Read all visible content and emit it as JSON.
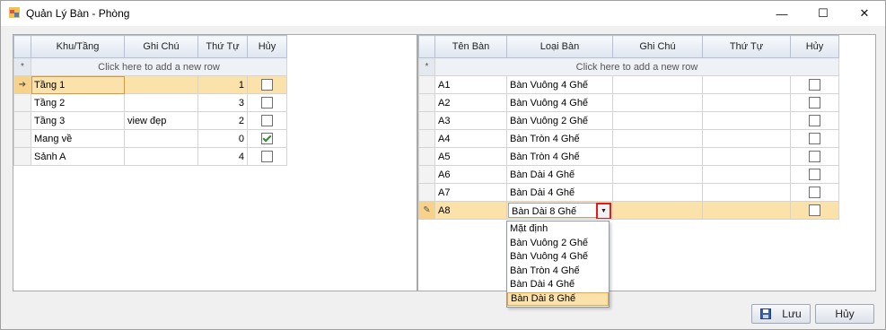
{
  "window": {
    "title": "Quản Lý Bàn - Phòng",
    "minimize_glyph": "—",
    "maximize_glyph": "☐",
    "close_glyph": "✕"
  },
  "left_grid": {
    "columns": [
      "Khu/Tầng",
      "Ghi Chú",
      "Thứ Tự",
      "Hủy"
    ],
    "new_row_text": "Click here to add a new row",
    "new_row_indicator": "*",
    "current_row_indicator": "➔",
    "rows": [
      {
        "area": "Tầng 1",
        "note": "",
        "order": "1",
        "cancel": false
      },
      {
        "area": "Tầng 2",
        "note": "",
        "order": "3",
        "cancel": false
      },
      {
        "area": "Tầng 3",
        "note": "view đẹp",
        "order": "2",
        "cancel": false
      },
      {
        "area": "Mang về",
        "note": "",
        "order": "0",
        "cancel": true
      },
      {
        "area": "Sảnh A",
        "note": "",
        "order": "4",
        "cancel": false
      }
    ]
  },
  "right_grid": {
    "columns": [
      "Tên Bàn",
      "Loại Bàn",
      "Ghi Chú",
      "Thứ Tự",
      "Hủy"
    ],
    "new_row_text": "Click here to add a new row",
    "new_row_indicator": "*",
    "edit_row_indicator": "✎",
    "rows": [
      {
        "name": "A1",
        "type": "Bàn Vuông 4 Ghế",
        "note": "",
        "order": "",
        "cancel": false
      },
      {
        "name": "A2",
        "type": "Bàn Vuông 4 Ghế",
        "note": "",
        "order": "",
        "cancel": false
      },
      {
        "name": "A3",
        "type": "Bàn Vuông 2 Ghế",
        "note": "",
        "order": "",
        "cancel": false
      },
      {
        "name": "A4",
        "type": "Bàn Tròn 4 Ghế",
        "note": "",
        "order": "",
        "cancel": false
      },
      {
        "name": "A5",
        "type": "Bàn Tròn 4 Ghế",
        "note": "",
        "order": "",
        "cancel": false
      },
      {
        "name": "A6",
        "type": "Bàn Dài 4 Ghế",
        "note": "",
        "order": "",
        "cancel": false
      },
      {
        "name": "A7",
        "type": "Bàn Dài 4 Ghế",
        "note": "",
        "order": "",
        "cancel": false
      },
      {
        "name": "A8",
        "type": "Bàn Dài 8 Ghế",
        "note": "",
        "order": "",
        "cancel": false
      }
    ],
    "dropdown_options": [
      "Mặt định",
      "Bàn Vuông 2 Ghế",
      "Bàn Vuông 4 Ghế",
      "Bàn Tròn 4 Ghế",
      "Bàn Dài 4 Ghế",
      "Bàn Dài 8 Ghế"
    ],
    "dropdown_selected": "Bàn Dài 8 Ghế"
  },
  "buttons": {
    "save_label": "Lưu",
    "cancel_label": "Hủy"
  },
  "colors": {
    "selected_row": "#fbe1aa",
    "combo_button_highlight": "#e31b1b",
    "checkbox_check": "#2e8b2e"
  }
}
